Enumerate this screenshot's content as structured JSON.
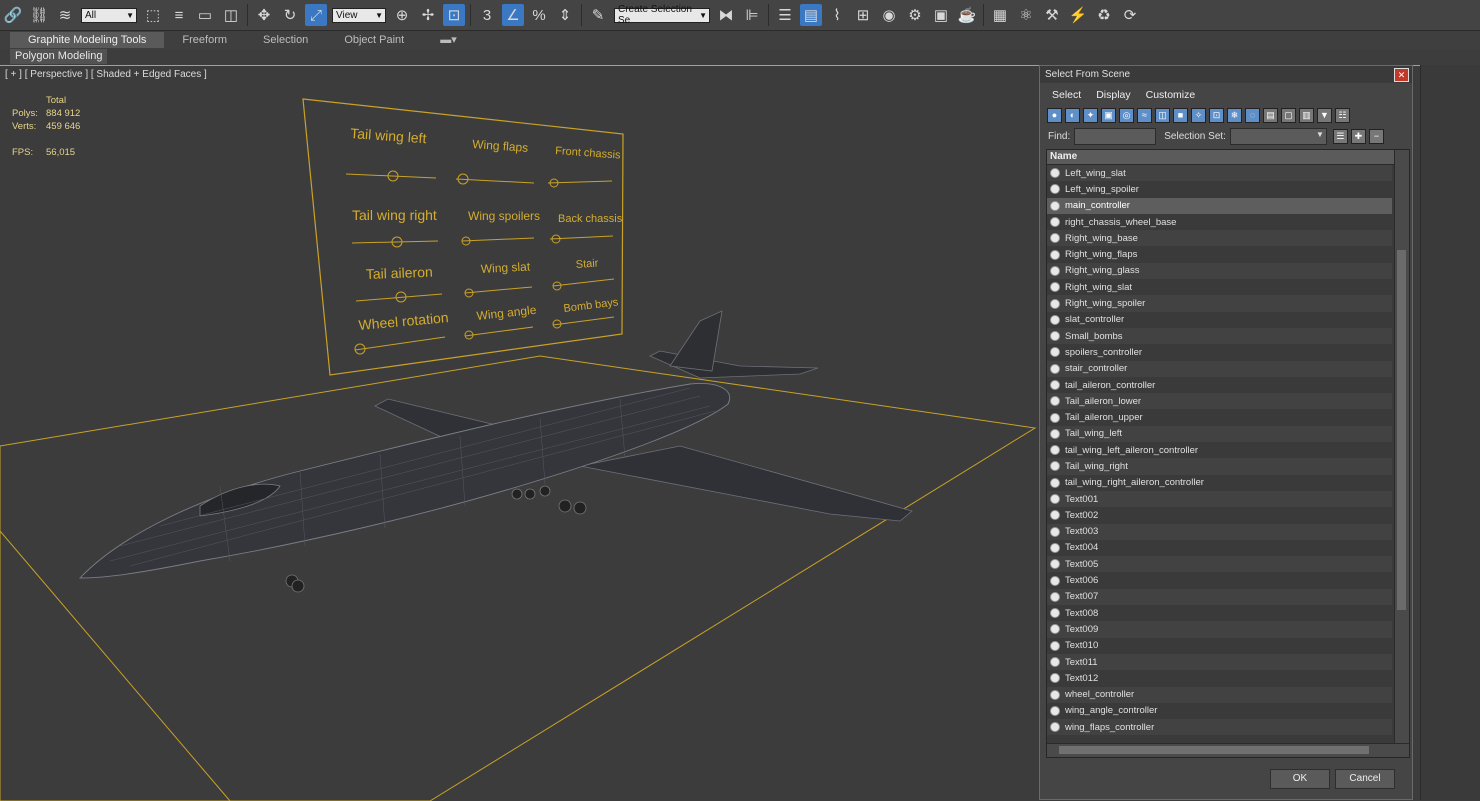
{
  "toolbar": {
    "filter_value": "All",
    "refcoord_value": "View",
    "selection_set_placeholder": "Create Selection Se"
  },
  "ribbon": {
    "tabs": [
      "Graphite Modeling Tools",
      "Freeform",
      "Selection",
      "Object Paint"
    ],
    "subtab": "Polygon Modeling"
  },
  "viewport": {
    "label": "[ + ] [ Perspective ] [ Shaded + Edged Faces ]",
    "stats": {
      "total_label": "Total",
      "polys_label": "Polys:",
      "polys_value": "884 912",
      "verts_label": "Verts:",
      "verts_value": "459 646",
      "fps_label": "FPS:",
      "fps_value": "56,015"
    },
    "panel_labels": [
      "Tail wing left",
      "Wing flaps",
      "Front chassis",
      "Tail wing right",
      "Wing spoilers",
      "Back chassis",
      "Tail aileron",
      "Wing slat",
      "Stair",
      "Wheel rotation",
      "Wing angle",
      "Bomb bays"
    ]
  },
  "dialog": {
    "title": "Select From Scene",
    "menu": [
      "Select",
      "Display",
      "Customize"
    ],
    "find_label": "Find:",
    "selection_set_label": "Selection Set:",
    "column_header": "Name",
    "items": [
      "Left_wing_slat",
      "Left_wing_spoiler",
      "main_controller",
      "right_chassis_wheel_base",
      "Right_wing_base",
      "Right_wing_flaps",
      "Right_wing_glass",
      "Right_wing_slat",
      "Right_wing_spoiler",
      "slat_controller",
      "Small_bombs",
      "spoilers_controller",
      "stair_controller",
      "tail_aileron_controller",
      "Tail_aileron_lower",
      "Tail_aileron_upper",
      "Tail_wing_left",
      "tail_wing_left_aileron_controller",
      "Tail_wing_right",
      "tail_wing_right_aileron_controller",
      "Text001",
      "Text002",
      "Text003",
      "Text004",
      "Text005",
      "Text006",
      "Text007",
      "Text008",
      "Text009",
      "Text010",
      "Text011",
      "Text012",
      "wheel_controller",
      "wing_angle_controller",
      "wing_flaps_controller"
    ],
    "selected_item": "main_controller",
    "ok_label": "OK",
    "cancel_label": "Cancel"
  },
  "colors": {
    "accent_gold": "#c9a227",
    "viewport_bg": "#3c3c3c",
    "selection_blue": "#3a78c4"
  }
}
